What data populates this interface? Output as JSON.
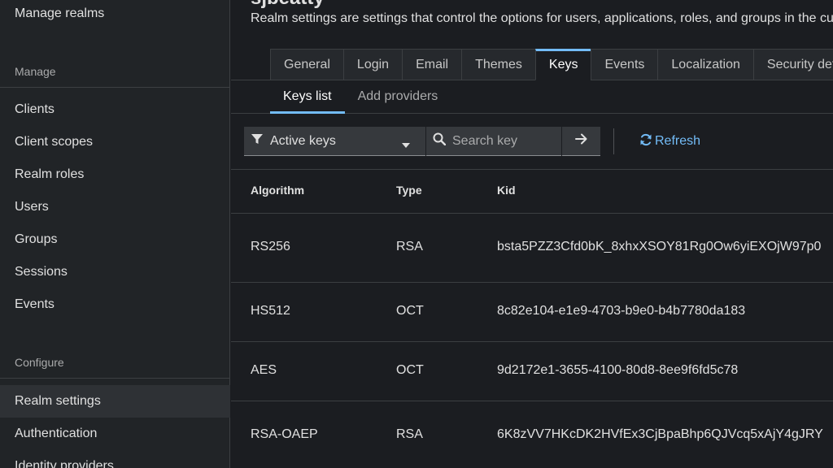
{
  "sidebar": {
    "top_item": "Manage realms",
    "sections": [
      {
        "label": "Manage",
        "items": [
          "Clients",
          "Client scopes",
          "Realm roles",
          "Users",
          "Groups",
          "Sessions",
          "Events"
        ]
      },
      {
        "label": "Configure",
        "items": [
          "Realm settings",
          "Authentication",
          "Identity providers"
        ]
      }
    ],
    "active_item": "Realm settings"
  },
  "header": {
    "title": "sjbeatty",
    "description": "Realm settings are settings that control the options for users, applications, roles, and groups in the current realm."
  },
  "tabs": [
    "General",
    "Login",
    "Email",
    "Themes",
    "Keys",
    "Events",
    "Localization",
    "Security defenses"
  ],
  "active_tab": "Keys",
  "subtabs": [
    "Keys list",
    "Add providers"
  ],
  "active_subtab": "Keys list",
  "toolbar": {
    "filter_value": "Active keys",
    "search_placeholder": "Search key",
    "refresh_label": "Refresh"
  },
  "table": {
    "columns": [
      "Algorithm",
      "Type",
      "Kid"
    ],
    "rows": [
      {
        "algorithm": "RS256",
        "type": "RSA",
        "kid": "bsta5PZZ3Cfd0bK_8xhxXSOY81Rg0Ow6yiEXOjW97p0"
      },
      {
        "algorithm": "HS512",
        "type": "OCT",
        "kid": "8c82e104-e1e9-4703-b9e0-b4b7780da183"
      },
      {
        "algorithm": "AES",
        "type": "OCT",
        "kid": "9d2172e1-3655-4100-80d8-8ee9f6fd5c78"
      },
      {
        "algorithm": "RSA-OAEP",
        "type": "RSA",
        "kid": "6K8zVV7HKcDK2HVfEx3CjBpaBhp6QJVcq5xAjY4gJRY"
      }
    ]
  },
  "colors": {
    "accent": "#73bcf7",
    "background": "#1b1d21",
    "sidebar": "#212427"
  }
}
